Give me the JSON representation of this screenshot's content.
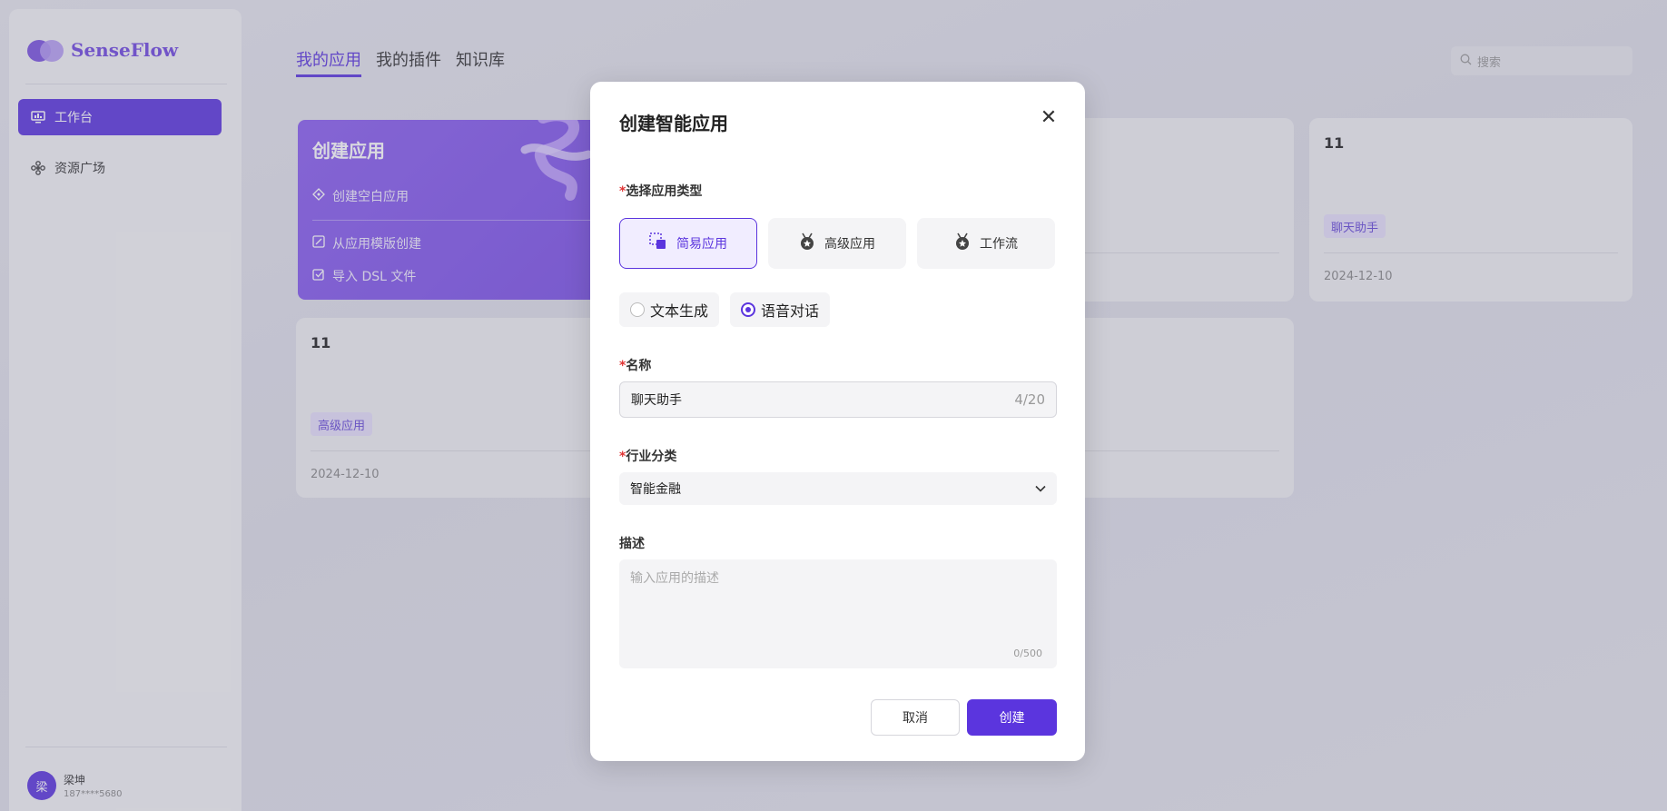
{
  "colors": {
    "accent": "#5b35de",
    "required": "#e03434"
  },
  "sidebar": {
    "brand": "SenseFlow",
    "items": [
      {
        "label": "工作台",
        "icon": "monitor-icon",
        "active": true
      },
      {
        "label": "资源广场",
        "icon": "flower-icon",
        "active": false
      }
    ],
    "user": {
      "avatar": "梁",
      "name": "梁坤",
      "phone": "187****5680"
    }
  },
  "header": {
    "tabs": [
      {
        "label": "我的应用",
        "active": true
      },
      {
        "label": "我的插件",
        "active": false
      },
      {
        "label": "知识库",
        "active": false
      }
    ],
    "search_placeholder": "搜索"
  },
  "create_card": {
    "title": "创建应用",
    "items": [
      "创建空白应用",
      "从应用模版创建",
      "导入 DSL 文件"
    ]
  },
  "cards": [
    {
      "title": "11",
      "tag": "聊天助手",
      "date": "2024-12-10"
    },
    {
      "title": "11",
      "tag": "高级应用",
      "date": "2024-12-10"
    }
  ],
  "modal": {
    "title": "创建智能应用",
    "type_label": "选择应用类型",
    "types": [
      {
        "label": "简易应用",
        "active": true
      },
      {
        "label": "高级应用",
        "active": false
      },
      {
        "label": "工作流",
        "active": false
      }
    ],
    "modes": [
      {
        "label": "文本生成",
        "selected": false
      },
      {
        "label": "语音对话",
        "selected": true
      }
    ],
    "name_label": "名称",
    "name_value": "聊天助手",
    "name_counter": "4/20",
    "industry_label": "行业分类",
    "industry_value": "智能金融",
    "desc_label": "描述",
    "desc_placeholder": "输入应用的描述",
    "desc_counter": "0/500",
    "cancel": "取消",
    "create": "创建"
  }
}
